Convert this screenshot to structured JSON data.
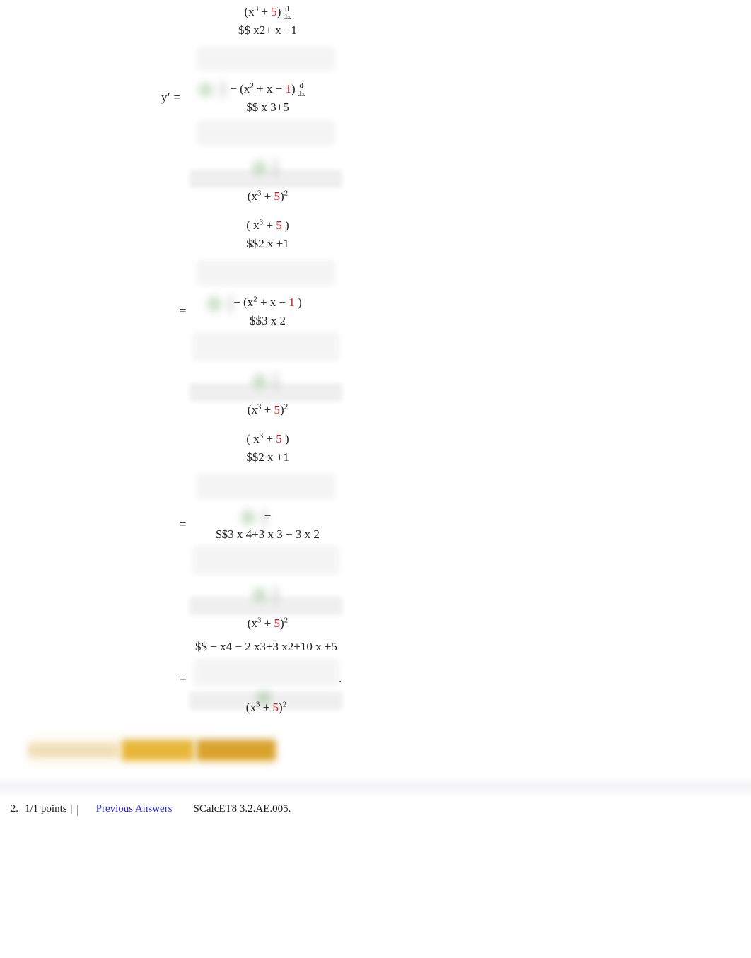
{
  "worksheet": {
    "steps": [
      {
        "id": "step1",
        "lhs": "y'  =",
        "numerator_line1_pre": "(x",
        "numerator_line1_exp": "3",
        "numerator_line1_mid": " + ",
        "numerator_line1_red": "5",
        "numerator_line1_post": ")",
        "numerator_ddx_top": "d",
        "numerator_ddx_bot": "dx",
        "numerator_line2": "$$ x2+  x− 1",
        "numerator_line3_pre": "−  (x",
        "numerator_line3_exp": "2",
        "numerator_line3_mid": " +  x  −  ",
        "numerator_line3_red": "1",
        "numerator_line3_post": ")",
        "numerator_line3_ddx_top": "d",
        "numerator_line3_ddx_bot": "dx",
        "numerator_line4": "$$ x 3+5",
        "denominator_pre": "(x",
        "denominator_exp": "3",
        "denominator_mid": " +  ",
        "denominator_red": "5",
        "denominator_post": ")",
        "denominator_power": "2"
      },
      {
        "id": "step2",
        "lhs": "=",
        "numerator_line1_pre": "( x",
        "numerator_line1_exp": "3",
        "numerator_line1_mid": "  +  ",
        "numerator_line1_red": "5",
        "numerator_line1_post": " )",
        "numerator_line2": "$$2  x +1",
        "numerator_line3_pre": "−  (x",
        "numerator_line3_exp": "2",
        "numerator_line3_mid": "  +   x  −  ",
        "numerator_line3_red": "1",
        "numerator_line3_post": " )",
        "numerator_line4": "$$3  x 2",
        "denominator_pre": "(x",
        "denominator_exp": "3",
        "denominator_mid": " +  ",
        "denominator_red": "5",
        "denominator_post": ")",
        "denominator_power": "2"
      },
      {
        "id": "step3",
        "lhs": "=",
        "numerator_line1_pre": "( x",
        "numerator_line1_exp": "3",
        "numerator_line1_mid": "  +  ",
        "numerator_line1_red": "5",
        "numerator_line1_post": " )",
        "numerator_line2": "$$2  x +1",
        "numerator_line3": "−",
        "numerator_line4": "$$3  x 4+3  x 3 − 3 x 2",
        "denominator_pre": "(x",
        "denominator_exp": "3",
        "denominator_mid": " +  ",
        "denominator_red": "5",
        "denominator_post": ")",
        "denominator_power": "2"
      },
      {
        "id": "step4",
        "lhs": "=",
        "numerator_line": "$$ − x4 − 2 x3+3  x2+10   x +5",
        "denominator_pre": "(x",
        "denominator_exp": "3",
        "denominator_mid": " +  ",
        "denominator_red": "5",
        "denominator_post": ")",
        "denominator_power": "2",
        "trailing_period": "."
      }
    ],
    "accent_red": "#dd1111",
    "text_color": "#222222"
  },
  "hint_banner": {
    "label": "",
    "color_pale": "#efdfb6",
    "color_mid": "#e8b73a",
    "color_strong": "#d9a22c"
  },
  "problem_header": {
    "number": "2.",
    "points": "1/1 points",
    "separator": "|",
    "previous_answers_link": "Previous Answers",
    "problem_code": "SCalcET8 3.2.AE.005.",
    "link_color": "#2a2ae0"
  }
}
